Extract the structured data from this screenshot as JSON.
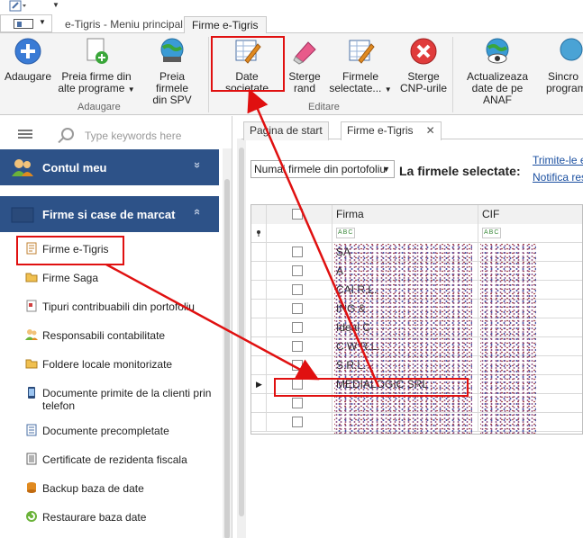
{
  "ribbon_tabs": [
    "e-Tigris  - Meniu principal",
    "Firme e-Tigris"
  ],
  "ribbon": {
    "groups": [
      {
        "label": "Adaugare",
        "buttons": [
          {
            "label": "Adaugare"
          },
          {
            "label": "Preia firme din alte programe",
            "line1": "Preia firme din",
            "line2": "alte programe",
            "dropdown": true
          },
          {
            "label": "Preia firmele din SPV",
            "line1": "Preia firmele",
            "line2": "din SPV"
          }
        ]
      },
      {
        "label": "Editare",
        "buttons": [
          {
            "label": "Date societate"
          },
          {
            "label": "Sterge rand",
            "line1": "Sterge",
            "line2": "rand"
          },
          {
            "label": "Firmele selectate...",
            "line1": "Firmele",
            "line2": "selectate...",
            "dropdown": true
          },
          {
            "label": "Sterge CNP-urile",
            "line1": "Sterge",
            "line2": "CNP-urile"
          }
        ]
      },
      {
        "label": "",
        "buttons": [
          {
            "label": "Actualizeaza date de pe ANAF",
            "line1": "Actualizeaza",
            "line2": "date de pe ANAF"
          },
          {
            "label": "Sincro program",
            "line1": "Sincro",
            "line2": "program"
          }
        ]
      }
    ]
  },
  "sidebar": {
    "search_placeholder": "Type keywords here",
    "sections": [
      {
        "title": "Contul meu",
        "chevron": "»"
      },
      {
        "title": "Firme si case de marcat",
        "chevron": "«"
      }
    ],
    "items": [
      {
        "label": "Firme e-Tigris",
        "icon": "document-list-icon"
      },
      {
        "label": "Firme Saga",
        "icon": "folder-icon"
      },
      {
        "label": "Tipuri contribuabili din portofoliu",
        "icon": "document-icon"
      },
      {
        "label": "Responsabili contabilitate",
        "icon": "people-icon"
      },
      {
        "label": "Foldere locale monitorizate",
        "icon": "folder-icon"
      },
      {
        "label": "Documente primite de la clienti prin telefon",
        "line1": "Documente primite de la clienti prin",
        "line2": "telefon",
        "icon": "phone-icon"
      },
      {
        "label": "Documente precompletate",
        "icon": "document-icon"
      },
      {
        "label": "Certificate de rezidenta fiscala",
        "icon": "certificate-icon"
      },
      {
        "label": "Backup baza de date",
        "icon": "database-icon"
      },
      {
        "label": "Restaurare baza date",
        "icon": "restore-icon"
      }
    ]
  },
  "doc_tabs": [
    {
      "label": "Pagina de start"
    },
    {
      "label": "Firme e-Tigris",
      "close": "✕"
    }
  ],
  "filter": {
    "combo_value": "Numai firmele din portofoliu",
    "selected_label": "La firmele selectate:",
    "links": [
      "Trimite-le em",
      "Notifica rest"
    ]
  },
  "grid": {
    "columns": [
      "",
      "",
      "Firma",
      "CIF"
    ],
    "filter_tag": "ABC",
    "rows": [
      {
        "firma": "SA",
        "visible": true
      },
      {
        "firma": "A",
        "visible": true
      },
      {
        "firma": "CAI                              R.L.",
        "visible": true
      },
      {
        "firma": "           ING &",
        "visible": true
      },
      {
        "firma": "         Ideal C",
        "visible": true
      },
      {
        "firma": "                  C W          R.L.",
        "visible": true
      },
      {
        "firma": "                 S.R.L.",
        "visible": true
      },
      {
        "firma": "MEDIALOGIC SRL",
        "current": true
      },
      {
        "firma": ""
      },
      {
        "firma": ""
      }
    ]
  },
  "colors": {
    "nav_header": "#2d5288",
    "annotation": "#e01010",
    "link": "#1a4fa0"
  }
}
